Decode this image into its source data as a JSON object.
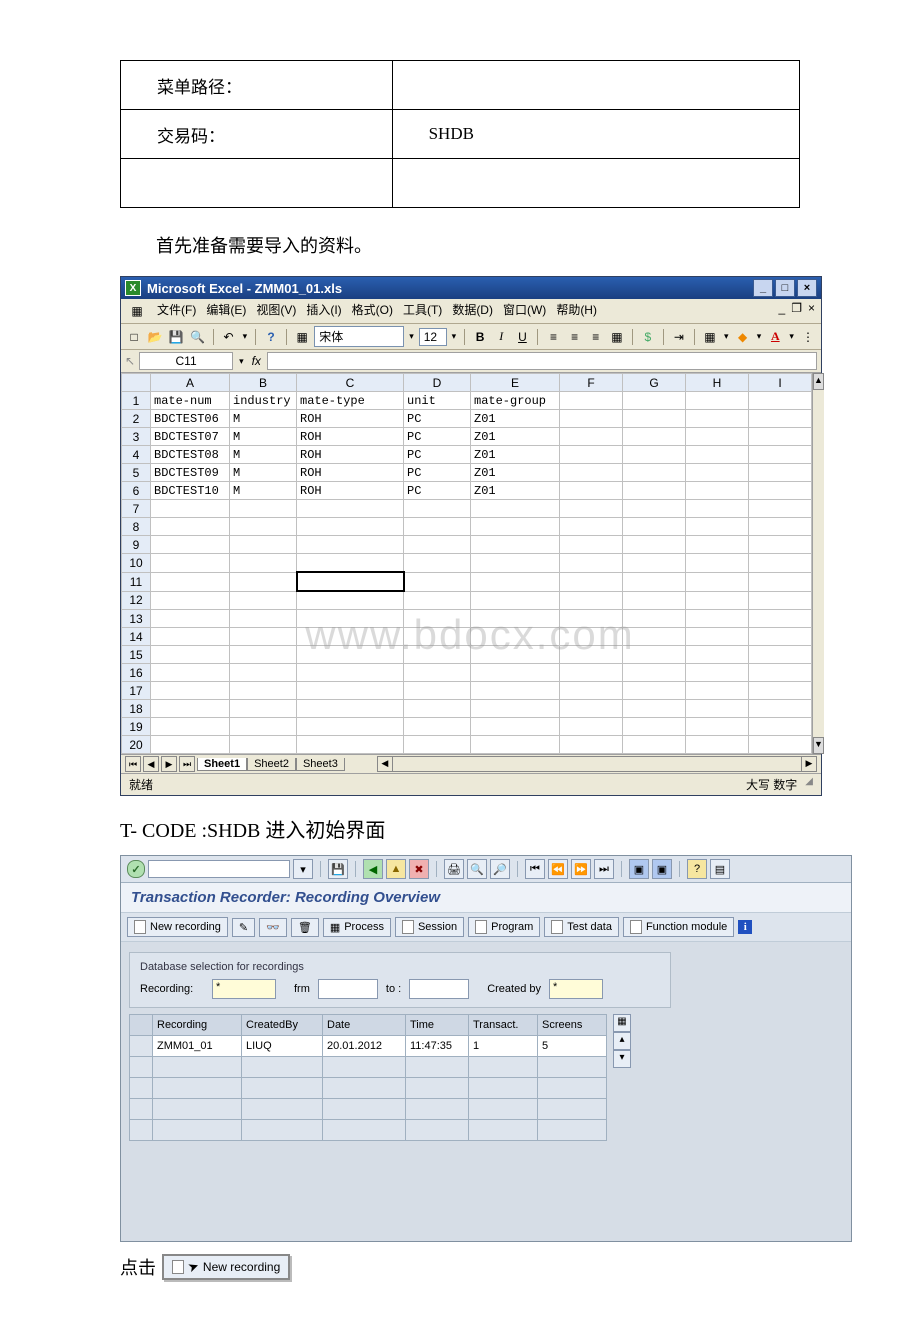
{
  "info_table": {
    "row1_label": "菜单路径：",
    "row1_value": "",
    "row2_label": "交易码：",
    "row2_value": "SHDB",
    "row3_label": "",
    "row3_value": ""
  },
  "para1": "首先准备需要导入的资料。",
  "excel": {
    "title": "Microsoft Excel - ZMM01_01.xls",
    "menus": {
      "file": "文件(F)",
      "edit": "编辑(E)",
      "view": "视图(V)",
      "insert": "插入(I)",
      "format": "格式(O)",
      "tools": "工具(T)",
      "data": "数据(D)",
      "window": "窗口(W)",
      "help": "帮助(H)"
    },
    "font_name": "宋体",
    "font_size": "12",
    "name_box": "C11",
    "columns": [
      "A",
      "B",
      "C",
      "D",
      "E",
      "F",
      "G",
      "H",
      "I"
    ],
    "header_row": [
      "mate-num",
      "industry",
      "mate-type",
      "unit",
      "mate-group",
      "",
      "",
      "",
      ""
    ],
    "rows": [
      [
        "BDCTEST06",
        "M",
        "ROH",
        "PC",
        "Z01",
        "",
        "",
        "",
        ""
      ],
      [
        "BDCTEST07",
        "M",
        "ROH",
        "PC",
        "Z01",
        "",
        "",
        "",
        ""
      ],
      [
        "BDCTEST08",
        "M",
        "ROH",
        "PC",
        "Z01",
        "",
        "",
        "",
        ""
      ],
      [
        "BDCTEST09",
        "M",
        "ROH",
        "PC",
        "Z01",
        "",
        "",
        "",
        ""
      ],
      [
        "BDCTEST10",
        "M",
        "ROH",
        "PC",
        "Z01",
        "",
        "",
        "",
        ""
      ]
    ],
    "visible_row_count": 20,
    "selected_cell": {
      "row": 11,
      "col": 3
    },
    "sheets": [
      "Sheet1",
      "Sheet2",
      "Sheet3"
    ],
    "active_sheet": 0,
    "status_left": "就绪",
    "status_right": "大写 数字"
  },
  "watermark": "www.bdocx.com",
  "heading2": "T- CODE :SHDB 进入初始界面",
  "sap": {
    "title": "Transaction Recorder: Recording Overview",
    "buttons": {
      "new_recording": "New recording",
      "process": "Process",
      "session": "Session",
      "program": "Program",
      "test_data": "Test data",
      "function_module": "Function module"
    },
    "panel": {
      "title": "Database selection for recordings",
      "recording_label": "Recording:",
      "recording_value": "*",
      "from_label": "frm",
      "to_label": "to :",
      "createdby_label": "Created by",
      "createdby_value": "*"
    },
    "grid": {
      "headers": [
        "Recording",
        "CreatedBy",
        "Date",
        "Time",
        "Transact.",
        "Screens"
      ],
      "widths": [
        80,
        72,
        74,
        54,
        60,
        60
      ],
      "rows": [
        [
          "ZMM01_01",
          "LIUQ",
          "20.01.2012",
          "11:47:35",
          "1",
          "5"
        ]
      ]
    }
  },
  "para2_prefix": "点击",
  "new_rec_inline": "New recording"
}
